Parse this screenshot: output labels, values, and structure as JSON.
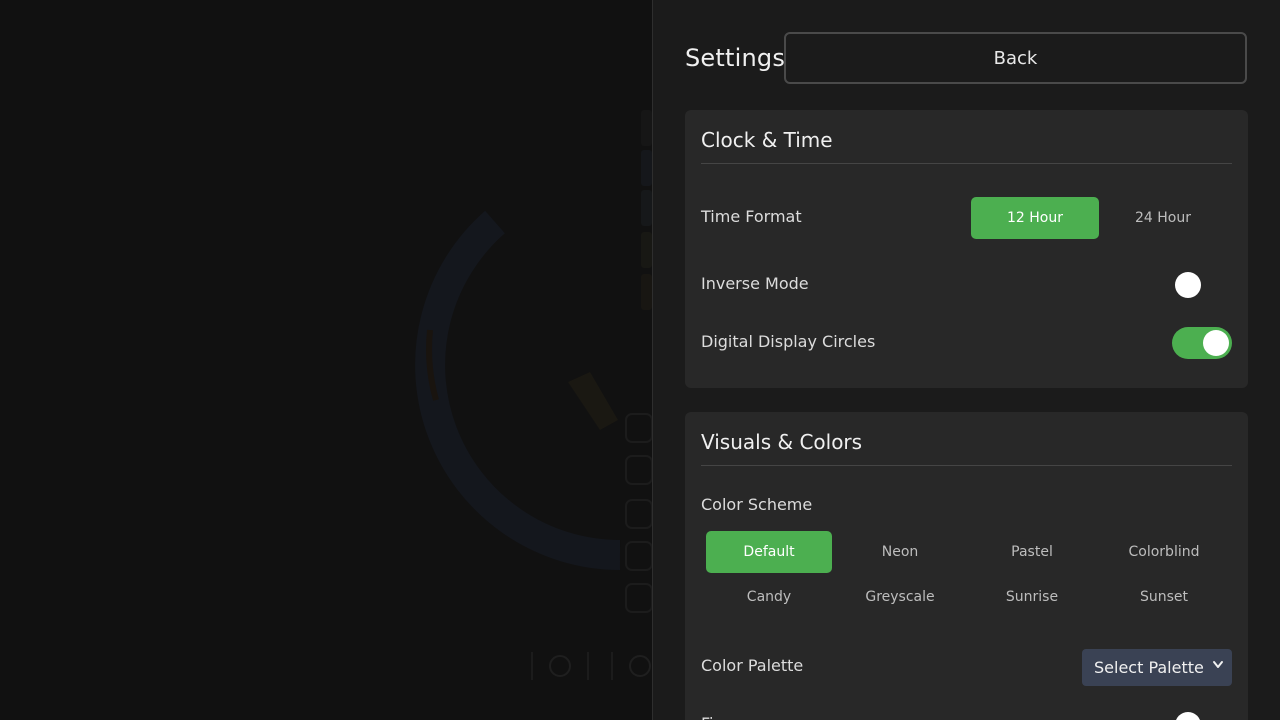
{
  "settings": {
    "title": "Settings",
    "back_label": "Back"
  },
  "clock": {
    "title": "Clock & Time",
    "time_format": {
      "label": "Time Format",
      "options": [
        "12 Hour",
        "24 Hour"
      ],
      "selected": "12 Hour"
    },
    "inverse_mode": {
      "label": "Inverse Mode",
      "enabled": false
    },
    "digital_circles": {
      "label": "Digital Display Circles",
      "enabled": true
    }
  },
  "visuals": {
    "title": "Visuals & Colors",
    "color_scheme": {
      "label": "Color Scheme",
      "options": [
        "Default",
        "Neon",
        "Pastel",
        "Colorblind",
        "Candy",
        "Greyscale",
        "Sunrise",
        "Sunset"
      ],
      "selected": "Default"
    },
    "color_palette": {
      "label": "Color Palette",
      "value": "Select Palette"
    },
    "next_row": {
      "label": "Fi"
    }
  },
  "colors": {
    "accent": "#4caf50",
    "panel_bg": "#1b1b1b",
    "card_bg": "#282828",
    "select_bg": "#3a4254"
  }
}
